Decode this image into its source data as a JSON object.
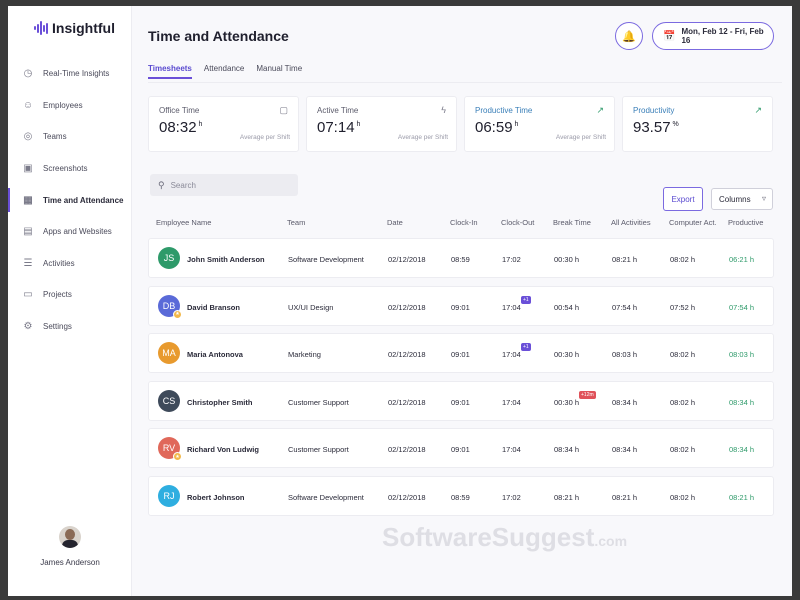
{
  "app": {
    "logo_text": "Insightful"
  },
  "sidebar": {
    "items": [
      {
        "label": "Real-Time Insights",
        "icon": "clock-icon",
        "active": false
      },
      {
        "label": "Employees",
        "icon": "users-icon",
        "active": false
      },
      {
        "label": "Teams",
        "icon": "teams-icon",
        "active": false
      },
      {
        "label": "Screenshots",
        "icon": "screenshot-icon",
        "active": false
      },
      {
        "label": "Time and Attendance",
        "icon": "calendar-icon",
        "active": true
      },
      {
        "label": "Apps and Websites",
        "icon": "apps-icon",
        "active": false
      },
      {
        "label": "Activities",
        "icon": "list-icon",
        "active": false
      },
      {
        "label": "Projects",
        "icon": "folder-icon",
        "active": false
      },
      {
        "label": "Settings",
        "icon": "gear-icon",
        "active": false
      }
    ],
    "user_name": "James Anderson"
  },
  "header": {
    "title": "Time and Attendance",
    "date_range": "Mon, Feb 12 - Fri, Feb 16"
  },
  "tabs": [
    {
      "label": "Timesheets",
      "active": true
    },
    {
      "label": "Attendance",
      "active": false
    },
    {
      "label": "Manual Time",
      "active": false
    }
  ],
  "stats": [
    {
      "label": "Office Time",
      "value": "08:32",
      "unit": "h",
      "sub": "Average per Shift",
      "icon": "briefcase-icon"
    },
    {
      "label": "Active Time",
      "value": "07:14",
      "unit": "h",
      "sub": "Average per Shift",
      "icon": "bolt-icon"
    },
    {
      "label": "Productive Time",
      "value": "06:59",
      "unit": "h",
      "sub": "Average per Shift",
      "icon": "trend-up-icon"
    },
    {
      "label": "Productivity",
      "value": "93.57",
      "unit": "%",
      "sub": "",
      "icon": "trend-up-icon"
    }
  ],
  "search": {
    "placeholder": "Search",
    "value": ""
  },
  "toolbar": {
    "export_label": "Export",
    "columns_label": "Columns"
  },
  "table": {
    "headers": [
      "Employee Name",
      "Team",
      "Date",
      "Clock-In",
      "Clock-Out",
      "Break Time",
      "All Activities",
      "Computer Act.",
      "Productive"
    ],
    "rows": [
      {
        "initials": "JS",
        "avatar_color": "#2e9a6a",
        "has_badge": false,
        "name": "John Smith Anderson",
        "team": "Software Development",
        "date": "02/12/2018",
        "clock_in": "08:59",
        "clock_out": "17:02",
        "clock_out_badge": "",
        "break": "00:30 h",
        "break_badge": "",
        "all": "08:21 h",
        "computer": "08:02 h",
        "productive": "06:21 h"
      },
      {
        "initials": "DB",
        "avatar_color": "#5a6ad8",
        "has_badge": true,
        "name": "David Branson",
        "team": "UX/UI Design",
        "date": "02/12/2018",
        "clock_in": "09:01",
        "clock_out": "17:04",
        "clock_out_badge": "+1",
        "break": "00:54 h",
        "break_badge": "",
        "all": "07:54 h",
        "computer": "07:52 h",
        "productive": "07:54 h"
      },
      {
        "initials": "MA",
        "avatar_color": "#e89a2e",
        "has_badge": false,
        "name": "Maria Antonova",
        "team": "Marketing",
        "date": "02/12/2018",
        "clock_in": "09:01",
        "clock_out": "17:04",
        "clock_out_badge": "+1",
        "break": "00:30 h",
        "break_badge": "",
        "all": "08:03 h",
        "computer": "08:02 h",
        "productive": "08:03 h"
      },
      {
        "initials": "CS",
        "avatar_color": "#3e4a5a",
        "has_badge": false,
        "name": "Christopher Smith",
        "team": "Customer Support",
        "date": "02/12/2018",
        "clock_in": "09:01",
        "clock_out": "17:04",
        "clock_out_badge": "",
        "break": "00:30 h",
        "break_badge": "+12m",
        "all": "08:34 h",
        "computer": "08:02 h",
        "productive": "08:34 h"
      },
      {
        "initials": "RV",
        "avatar_color": "#e0685a",
        "has_badge": true,
        "name": "Richard Von Ludwig",
        "team": "Customer Support",
        "date": "02/12/2018",
        "clock_in": "09:01",
        "clock_out": "17:04",
        "clock_out_badge": "",
        "break": "08:34 h",
        "break_badge": "",
        "all": "08:34 h",
        "computer": "08:02 h",
        "productive": "08:34 h"
      },
      {
        "initials": "RJ",
        "avatar_color": "#2eaee0",
        "has_badge": false,
        "name": "Robert Johnson",
        "team": "Software Development",
        "date": "02/12/2018",
        "clock_in": "08:59",
        "clock_out": "17:02",
        "clock_out_badge": "",
        "break": "08:21 h",
        "break_badge": "",
        "all": "08:21 h",
        "computer": "08:02 h",
        "productive": "08:21 h"
      }
    ]
  },
  "watermark": {
    "main": "SoftwareSuggest",
    "suffix": ".com"
  }
}
